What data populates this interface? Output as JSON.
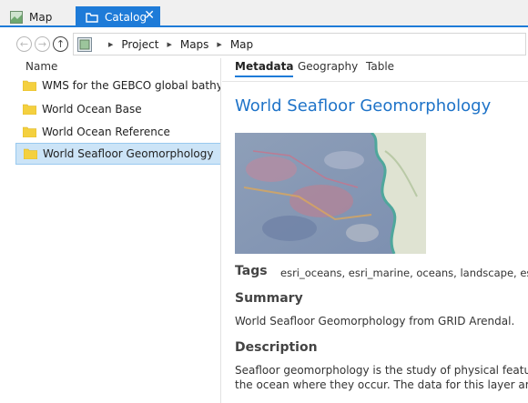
{
  "tabs": [
    {
      "label": "Map",
      "icon": "map-icon",
      "active": false
    },
    {
      "label": "Catalog",
      "icon": "catalog-icon",
      "active": true
    }
  ],
  "colors": {
    "accent": "#1e7bd8",
    "selected_row": "#cce4f7",
    "title": "#1e73c8",
    "folder": "#f4d03f"
  },
  "breadcrumb": [
    "Project",
    "Maps",
    "Map"
  ],
  "tree": {
    "column_header": "Name",
    "items": [
      {
        "label": "WMS for the GEBCO global bathymetric grid",
        "selected": false
      },
      {
        "label": "World Ocean Base",
        "selected": false
      },
      {
        "label": "World Ocean Reference",
        "selected": false
      },
      {
        "label": "World Seafloor Geomorphology",
        "selected": true
      }
    ]
  },
  "metadata": {
    "subtabs": [
      "Metadata",
      "Geography",
      "Table"
    ],
    "title": "World Seafloor Geomorphology",
    "tags_label": "Tags",
    "tags_value": "esri_oceans, esri_marine, oceans, landscape, esri",
    "summary_label": "Summary",
    "summary_text": "World Seafloor Geomorphology from GRID Arendal.",
    "description_label": "Description",
    "description_line1": "Seafloor geomorphology is the study of physical features",
    "description_line2": "the ocean where they occur. The data for this layer are"
  }
}
